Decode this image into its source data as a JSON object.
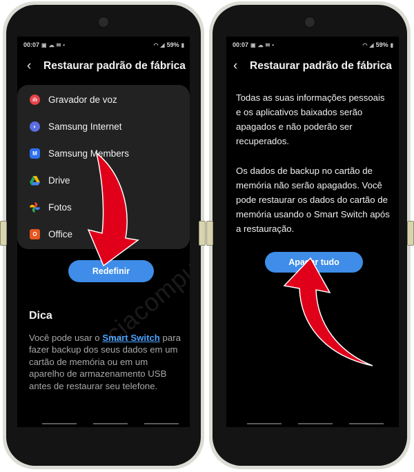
{
  "left_screen": {
    "status": {
      "time": "00:07",
      "battery": "59%"
    },
    "header": {
      "back_symbol": "‹",
      "title": "Restaurar padrão de fábrica"
    },
    "apps": [
      {
        "name": "Gravador de voz",
        "icon": "voice-recorder-icon",
        "color": "#e8434a"
      },
      {
        "name": "Samsung Internet",
        "icon": "samsung-internet-icon",
        "color": "#5b6ee1"
      },
      {
        "name": "Samsung Members",
        "icon": "samsung-members-icon",
        "color": "#2f6ff0"
      },
      {
        "name": "Drive",
        "icon": "google-drive-icon",
        "color": "#1fa463"
      },
      {
        "name": "Fotos",
        "icon": "google-photos-icon",
        "color": "#f4b400"
      },
      {
        "name": "Office",
        "icon": "office-icon",
        "color": "#e8561e"
      }
    ],
    "reset_button": "Redefinir",
    "tip": {
      "title": "Dica",
      "text_before": "Você pode usar o ",
      "link": "Smart Switch",
      "text_after": " para fazer backup dos seus dados em um cartão de memória ou em um aparelho de armazenamento USB antes de restaurar seu telefone."
    }
  },
  "right_screen": {
    "status": {
      "time": "00:07",
      "battery": "59%"
    },
    "header": {
      "back_symbol": "‹",
      "title": "Restaurar padrão de fábrica"
    },
    "paragraph1": "Todas as suas informações pessoais e os aplicativos baixados serão apagados e não poderão ser recuperados.",
    "paragraph2": "Os dados de backup no cartão de memória não serão apagados. Você pode restaurar os dados do cartão de memória usando o Smart Switch após a restauração.",
    "erase_button": "Apagar tudo"
  },
  "watermark": "ciacomputadores.com",
  "colors": {
    "accent": "#3f8de8",
    "arrow": "#e0001a",
    "link": "#4aa3ff"
  }
}
